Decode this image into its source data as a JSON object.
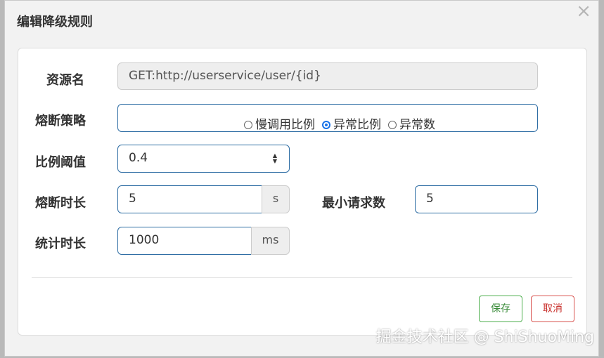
{
  "modal": {
    "title": "编辑降级规则",
    "close_icon": "×"
  },
  "form": {
    "resource": {
      "label": "资源名",
      "value": "GET:http://userservice/user/{id}"
    },
    "strategy": {
      "label": "熔断策略",
      "options": [
        {
          "label": "慢调用比例",
          "checked": false
        },
        {
          "label": "异常比例",
          "checked": true
        },
        {
          "label": "异常数",
          "checked": false
        }
      ]
    },
    "ratio": {
      "label": "比例阈值",
      "value": "0.4"
    },
    "break_duration": {
      "label": "熔断时长",
      "value": "5",
      "unit": "s"
    },
    "min_requests": {
      "label": "最小请求数",
      "value": "5"
    },
    "stat_duration": {
      "label": "统计时长",
      "value": "1000",
      "unit": "ms"
    }
  },
  "buttons": {
    "save": "保存",
    "cancel": "取消"
  },
  "watermark": "掘金技术社区 @ ShiShuoMing",
  "colors": {
    "field_border": "#2e6da4",
    "save": "#4cae4c",
    "cancel": "#d9534f",
    "radio_checked": "#1a73e8"
  }
}
